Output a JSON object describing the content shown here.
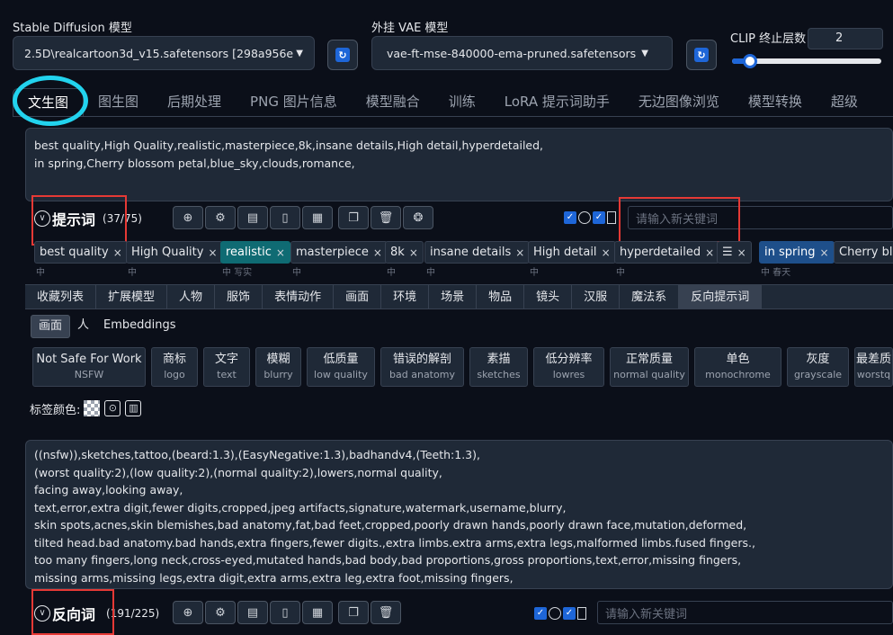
{
  "header": {
    "sd_model_label": "Stable Diffusion 模型",
    "sd_model_value": "2.5D\\realcartoon3d_v15.safetensors [298a956e",
    "vae_label": "外挂 VAE 模型",
    "vae_value": "vae-ft-mse-840000-ema-pruned.safetensors",
    "clip_label": "CLIP 终止层数",
    "clip_value": "2",
    "clip_slider_fraction": 0.12
  },
  "tabs": [
    "文生图",
    "图生图",
    "后期处理",
    "PNG 图片信息",
    "模型融合",
    "训练",
    "LoRA 提示词助手",
    "无边图像浏览",
    "模型转换",
    "超级"
  ],
  "prompt": {
    "text": "best quality,High Quality,realistic,masterpiece,8k,insane details,High detail,hyperdetailed,\nin spring,Cherry blossom petal,blue_sky,clouds,romance,",
    "toolbar_title": "提示词",
    "toolbar_count": "(37/75)",
    "keyword_placeholder": "请输入新关键词"
  },
  "chips": [
    {
      "label": "best quality",
      "sub": "中"
    },
    {
      "label": "High Quality",
      "sub": "中"
    },
    {
      "label": "realistic",
      "sub": "中 写实"
    },
    {
      "label": "masterpiece",
      "sub": "中"
    },
    {
      "label": "8k",
      "sub": "中"
    },
    {
      "label": "insane details",
      "sub": "中"
    },
    {
      "label": "High detail",
      "sub": "中"
    },
    {
      "label": "hyperdetailed",
      "sub": "中"
    },
    {
      "label": "",
      "sub": ""
    },
    {
      "label": "in spring",
      "sub": "中 春天"
    },
    {
      "label": "Cherry blo",
      "sub": ""
    }
  ],
  "categories": [
    "收藏列表",
    "扩展模型",
    "人物",
    "服饰",
    "表情动作",
    "画面",
    "环境",
    "场景",
    "物品",
    "镜头",
    "汉服",
    "魔法系",
    "反向提示词"
  ],
  "subtabs": [
    "画面",
    "人",
    "Embeddings"
  ],
  "negative_tags": [
    {
      "label": "Not Safe For Work",
      "sub": "NSFW"
    },
    {
      "label": "商标",
      "sub": "logo"
    },
    {
      "label": "文字",
      "sub": "text"
    },
    {
      "label": "模糊",
      "sub": "blurry"
    },
    {
      "label": "低质量",
      "sub": "low quality"
    },
    {
      "label": "错误的解剖",
      "sub": "bad anatomy"
    },
    {
      "label": "素描",
      "sub": "sketches"
    },
    {
      "label": "低分辨率",
      "sub": "lowres"
    },
    {
      "label": "正常质量",
      "sub": "normal quality"
    },
    {
      "label": "单色",
      "sub": "monochrome"
    },
    {
      "label": "灰度",
      "sub": "grayscale"
    },
    {
      "label": "最差质",
      "sub": "worstq"
    }
  ],
  "tag_color_label": "标签颜色:",
  "negative_prompt": {
    "text": "((nsfw)),sketches,tattoo,(beard:1.3),(EasyNegative:1.3),badhandv4,(Teeth:1.3),\n(worst quality:2),(low quality:2),(normal quality:2),lowers,normal quality,\nfacing away,looking away,\ntext,error,extra digit,fewer digits,cropped,jpeg artifacts,signature,watermark,username,blurry,\nskin spots,acnes,skin blemishes,bad anatomy,fat,bad feet,cropped,poorly drawn hands,poorly drawn face,mutation,deformed,\ntilted head.bad anatomy.bad hands,extra fingers,fewer digits.,extra limbs.extra arms,extra legs,malformed limbs.fused fingers.,\ntoo many fingers,long neck,cross-eyed,mutated hands,bad body,bad proportions,gross proportions,text,error,missing fingers,\nmissing arms,missing legs,extra digit,extra arms,extra leg,extra foot,missing fingers,",
    "toolbar_title": "反向词",
    "toolbar_count": "(191/225)",
    "keyword_placeholder": "请输入新关键词"
  },
  "colors": {
    "accent_ring": "#22d3ee",
    "highlight_box": "#e53935",
    "chip_teal": "#0f6b73",
    "chip_blue": "#1e4f8a"
  }
}
